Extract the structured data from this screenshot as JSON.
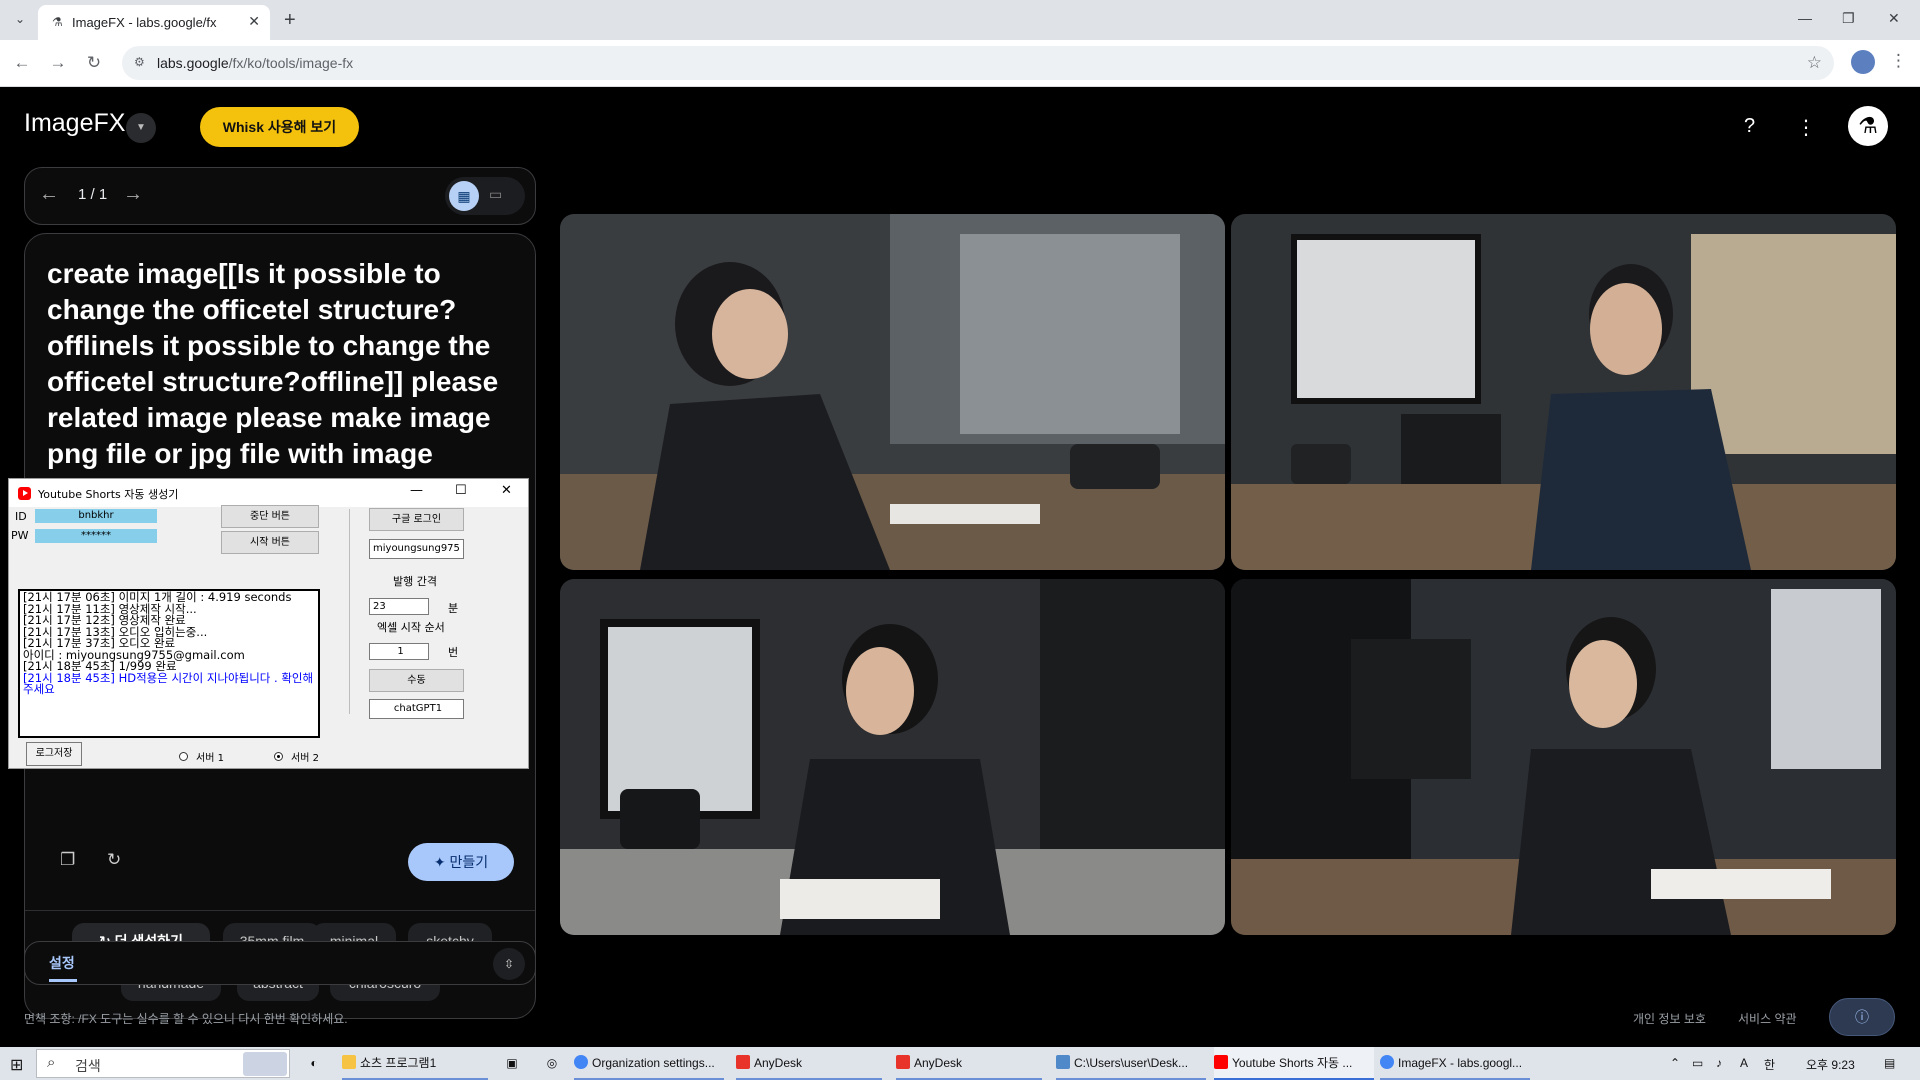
{
  "browser": {
    "tab_title": "ImageFX - labs.google/fx",
    "url_host": "labs.google",
    "url_path": "/fx/ko/tools/image-fx"
  },
  "app": {
    "brand": "ImageFX",
    "whisk_button": "Whisk 사용해 보기",
    "pager": "1 / 1",
    "prompt": "create image[[Is it possible to change the officetel structure? offlinels it possible to change the officetel structure?offline]]  please related image please make image png file or jpg file with image generator / i need",
    "make_button": "만들기",
    "chips": [
      "더 생성하기",
      "35mm film",
      "minimal",
      "sketchy",
      "handmade",
      "abstract",
      "chiaroscuro"
    ],
    "settings_label": "설정",
    "disclaimer": "면책 조항: /FX 도구는 실수를 할 수 있으니 다시 한번 확인하세요.",
    "privacy": "개인 정보 보호",
    "terms": "서비스 약관"
  },
  "yt_window": {
    "title": "Youtube Shorts 자동 생성기",
    "id_label": "ID",
    "id_value": "bnbkhr",
    "pw_label": "PW",
    "pw_value": "******",
    "stop_button": "중단 버튼",
    "start_button": "시작 버튼",
    "google_login": "구글 로그인",
    "email_field": "miyoungsung975",
    "interval_label": "발행 간격",
    "interval_value": "23",
    "interval_unit": "분",
    "excel_label": "엑셀 시작 순서",
    "excel_value": "1",
    "excel_unit": "번",
    "manual_button": "수동",
    "chatgpt_button": "chatGPT1",
    "log_lines": [
      "[21시 17분 06초] 이미지 1개 길이 : 4.919 seconds",
      "[21시 17분 11초] 영상제작 시작...",
      "[21시 17분 12초] 영상제작 완료",
      "[21시 17분 13초] 오디오 입히는중...",
      "[21시 17분 37초] 오디오 완료",
      "아이디 : miyoungsung9755@gmail.com",
      "[21시 18분 45초] 1/999 완료"
    ],
    "log_blue": "[21시 18분 45초] HD적용은 시간이 지나야됩니다 . 확인해주세요",
    "log_save": "로그저장",
    "server1": "서버 1",
    "server2": "서버 2",
    "selected_server": "서버 2"
  },
  "taskbar": {
    "search": "검색",
    "items": [
      "쇼츠 프로그램1",
      "Organization settings...",
      "AnyDesk",
      "AnyDesk",
      "C:\\Users\\user\\Desk...",
      "Youtube Shorts 자동 ...",
      "ImageFX - labs.googl..."
    ],
    "time": "오후 9:23"
  },
  "colors": {
    "accent_yellow": "#f4c20d",
    "accent_blue": "#a8c7fa",
    "background": "#000000"
  }
}
